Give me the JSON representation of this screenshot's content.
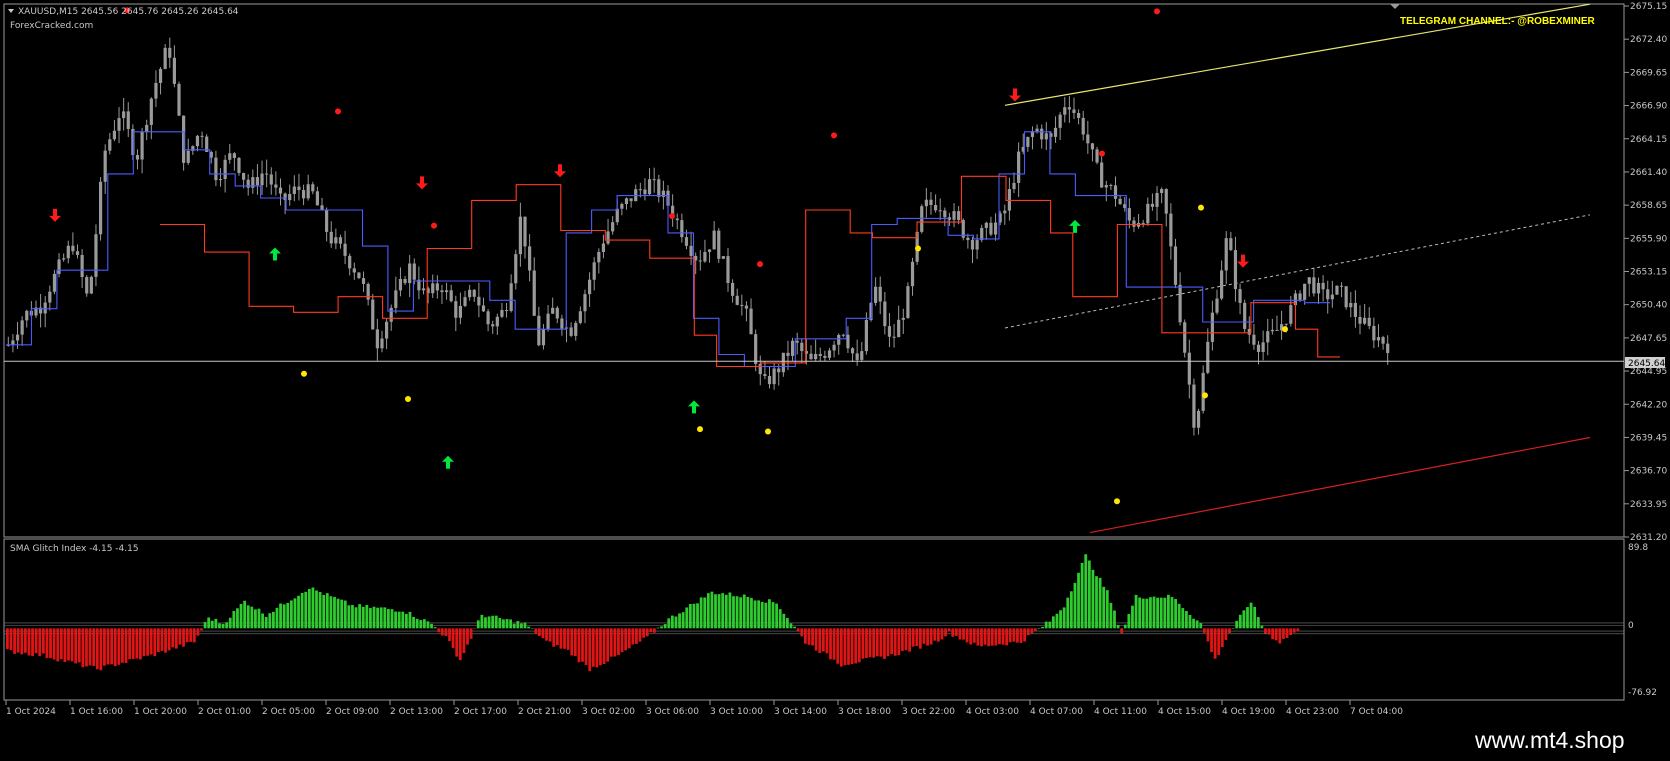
{
  "chart_header": {
    "symbol_line": "XAUUSD,M15  2645.56 2645.76 2645.26 2645.64",
    "source": "ForexCracked.com"
  },
  "telegram": "TELEGRAM CHANNEL:- @ROBEXMINER",
  "watermark": "www.mt4.shop",
  "current_price_tag": "2645.64",
  "indicator": {
    "label": "SMA Glitch Index -4.15 -4.15",
    "scale_top": "89.8",
    "scale_bottom": "-76.92",
    "scale_zero": "0"
  },
  "colors": {
    "background": "#000000",
    "candle": "#9a9a9a",
    "line_blue": "#4a5cff",
    "line_red": "#ff3b1f",
    "up_arrow": "#00e83a",
    "down_arrow": "#ff1a1a",
    "dot_yellow": "#ffe600",
    "dot_red": "#ff1a1a",
    "hist_pos": "#2ecc2e",
    "hist_neg": "#e01515",
    "trend_yellow": "#e8e870",
    "trend_red": "#d42020",
    "axis_text": "#c8c8c8"
  },
  "chart_data": [
    {
      "type": "candlestick",
      "price_axis_labels": [
        "2675.15",
        "2672.40",
        "2669.65",
        "2666.90",
        "2664.15",
        "2661.40",
        "2658.65",
        "2655.90",
        "2653.15",
        "2650.40",
        "2647.65",
        "2644.95",
        "2642.20",
        "2639.45",
        "2636.70",
        "2633.95",
        "2631.20"
      ],
      "time_axis_labels": [
        "1 Oct 2024",
        "1 Oct 16:00",
        "1 Oct 20:00",
        "2 Oct 01:00",
        "2 Oct 05:00",
        "2 Oct 09:00",
        "2 Oct 13:00",
        "2 Oct 17:00",
        "2 Oct 21:00",
        "3 Oct 02:00",
        "3 Oct 06:00",
        "3 Oct 10:00",
        "3 Oct 14:00",
        "3 Oct 18:00",
        "3 Oct 22:00",
        "4 Oct 03:00",
        "4 Oct 07:00",
        "4 Oct 11:00",
        "4 Oct 15:00",
        "4 Oct 19:00",
        "4 Oct 23:00",
        "7 Oct 04:00"
      ],
      "ylim": [
        2631.2,
        2675.15
      ],
      "close_path": [
        2647.0,
        2649.5,
        2650.2,
        2653.0,
        2655.5,
        2650.5,
        2663.0,
        2666.5,
        2662.5,
        2668.0,
        2672.0,
        2662.0,
        2665.0,
        2661.0,
        2663.0,
        2660.0,
        2661.5,
        2658.8,
        2660.0,
        2659.5,
        2656.0,
        2654.5,
        2652.5,
        2647.2,
        2650.5,
        2653.5,
        2651.0,
        2652.0,
        2649.5,
        2651.5,
        2648.5,
        2650.0,
        2658.0,
        2647.0,
        2650.0,
        2648.0,
        2651.5,
        2655.5,
        2658.0,
        2659.5,
        2660.5,
        2659.0,
        2656.5,
        2654.0,
        2656.0,
        2652.0,
        2649.5,
        2643.5,
        2645.0,
        2647.2,
        2645.5,
        2646.5,
        2648.5,
        2645.0,
        2652.0,
        2647.0,
        2650.5,
        2658.5,
        2658.8,
        2657.5,
        2655.5,
        2656.5,
        2657.5,
        2662.5,
        2665.0,
        2664.0,
        2667.5,
        2665.0,
        2661.0,
        2659.5,
        2657.0,
        2658.0,
        2659.5,
        2650.0,
        2640.0,
        2649.0,
        2656.0,
        2648.5,
        2647.0,
        2648.0,
        2650.0,
        2652.5,
        2651.0,
        2651.5,
        2649.5,
        2648.0,
        2647.0
      ],
      "blue_line": [
        2647.0,
        2650.0,
        2653.2,
        2653.2,
        2661.2,
        2664.7,
        2664.7,
        2663.2,
        2661.2,
        2660.2,
        2659.2,
        2658.2,
        2658.2,
        2658.2,
        2655.2,
        2649.8,
        2652.3,
        2652.3,
        2652.3,
        2650.7,
        2648.3,
        2648.3,
        2656.3,
        2658.2,
        2659.4,
        2659.4,
        2656.3,
        2649.2,
        2646.2,
        2645.2,
        2645.2,
        2647.5,
        2647.5,
        2649.2,
        2657.0,
        2657.5,
        2657.5,
        2656.1,
        2655.8,
        2661.2,
        2664.7,
        2661.2,
        2659.4,
        2659.4,
        2651.8,
        2651.8,
        2651.8,
        2648.9,
        2648.9,
        2650.7,
        2650.7,
        2650.5
      ],
      "red_line": [
        2657.0,
        2657.0,
        2654.7,
        2654.7,
        2650.2,
        2650.2,
        2649.7,
        2649.7,
        2651.0,
        2651.0,
        2649.2,
        2649.2,
        2655.0,
        2655.0,
        2659.0,
        2659.0,
        2660.3,
        2660.3,
        2656.5,
        2656.5,
        2655.7,
        2655.7,
        2654.2,
        2654.2,
        2647.8,
        2645.2,
        2645.2,
        2645.5,
        2645.5,
        2658.2,
        2658.2,
        2656.3,
        2655.9,
        2655.9,
        2657.2,
        2657.2,
        2661.0,
        2661.0,
        2659.0,
        2659.0,
        2656.3,
        2651.0,
        2651.0,
        2657.0,
        2657.0,
        2648.0,
        2648.0,
        2648.0,
        2648.0,
        2650.5,
        2650.5,
        2648.3,
        2646.0
      ],
      "current_price": 2645.64,
      "signals": {
        "up_arrows": [
          2654.5,
          2637.2,
          2641.8,
          2656.8
        ],
        "down_arrows": [
          2657.8,
          2660.5,
          2661.5,
          2667.8,
          2654.0
        ],
        "yellow_dots": [
          2644.6,
          2642.5,
          2640.0,
          2639.8,
          2655.0,
          2658.4,
          2634.0,
          2642.8,
          2648.3
        ],
        "red_dots": [
          2674.8,
          2656.9,
          2666.4,
          2657.7,
          2653.7,
          2664.4,
          2662.9,
          2674.7
        ]
      }
    },
    {
      "type": "bar",
      "title": "SMA Glitch Index -4.15 -4.15",
      "ylim": [
        -76.92,
        89.8
      ],
      "positive_color": "#2ecc2e",
      "negative_color": "#e01515"
    }
  ]
}
